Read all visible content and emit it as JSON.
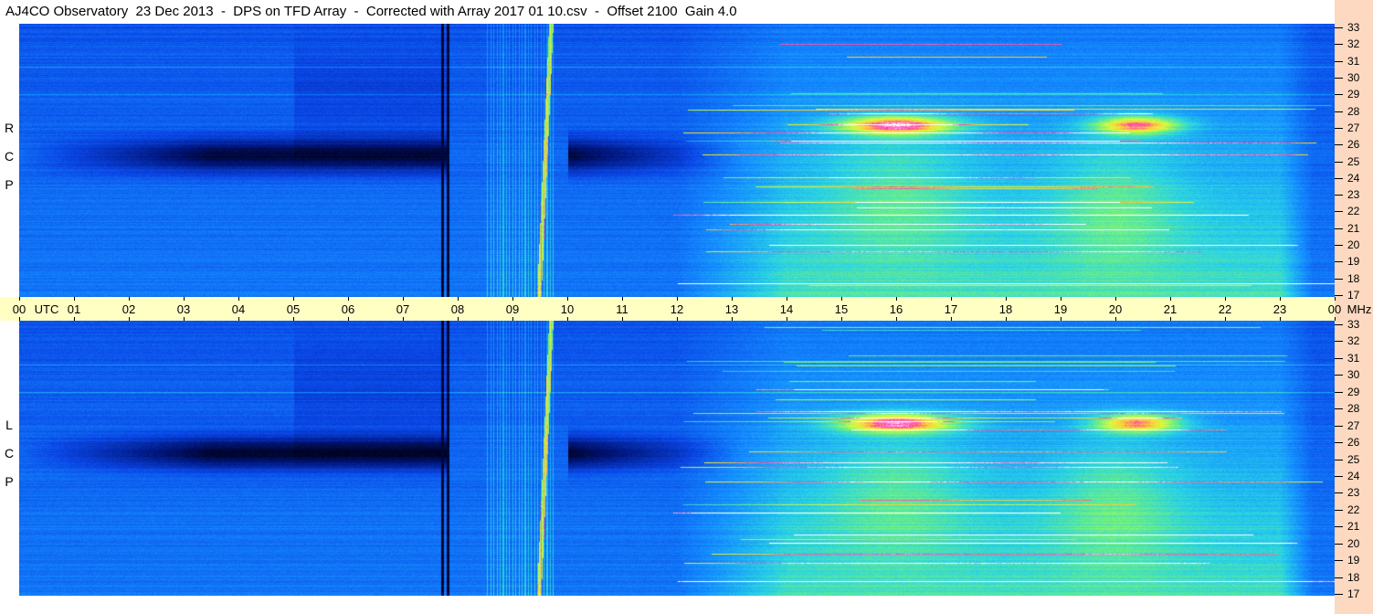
{
  "title": "AJ4CO Observatory  23 Dec 2013  -  DPS on TFD Array  -  Corrected with Array 2017 01 10.csv  -  Offset 2100  Gain 4.0",
  "colors": {
    "background": "#0a3fd0",
    "time_axis": "#ffffc4",
    "freq_axis": "#fcd9c0"
  },
  "chart_data": [
    {
      "type": "heatmap",
      "name": "RCP",
      "polarization_letters": [
        "R",
        "C",
        "P"
      ],
      "x_axis": {
        "unit": "UTC",
        "range": [
          "00",
          "24"
        ]
      },
      "y_axis": {
        "unit": "MHz",
        "range": [
          17,
          33
        ]
      },
      "xticks": [
        "00",
        "01",
        "02",
        "03",
        "04",
        "05",
        "06",
        "07",
        "08",
        "09",
        "10",
        "11",
        "12",
        "13",
        "14",
        "15",
        "16",
        "17",
        "18",
        "19",
        "20",
        "21",
        "22",
        "23",
        "00"
      ],
      "yticks": [
        17,
        18,
        19,
        20,
        21,
        22,
        23,
        24,
        25,
        26,
        27,
        28,
        29,
        30,
        31,
        32,
        33
      ]
    },
    {
      "type": "heatmap",
      "name": "LCP",
      "polarization_letters": [
        "L",
        "C",
        "P"
      ],
      "x_axis": {
        "unit": "UTC",
        "range": [
          "00",
          "24"
        ]
      },
      "y_axis": {
        "unit": "MHz",
        "range": [
          17,
          33
        ]
      },
      "xticks": [
        "00",
        "01",
        "02",
        "03",
        "04",
        "05",
        "06",
        "07",
        "08",
        "09",
        "10",
        "11",
        "12",
        "13",
        "14",
        "15",
        "16",
        "17",
        "18",
        "19",
        "20",
        "21",
        "22",
        "23",
        "00"
      ],
      "yticks": [
        17,
        18,
        19,
        20,
        21,
        22,
        23,
        24,
        25,
        26,
        27,
        28,
        29,
        30,
        31,
        32,
        33
      ]
    }
  ],
  "axis_labels": {
    "time_unit": "UTC",
    "freq_unit": "MHz"
  }
}
